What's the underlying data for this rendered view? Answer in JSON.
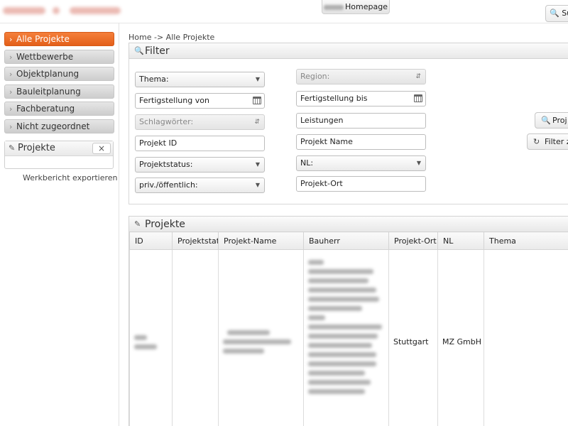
{
  "header": {
    "homepage_label": "Homepage",
    "search_label": "Su"
  },
  "sidebar": {
    "items": [
      {
        "label": "Alle Projekte",
        "active": true
      },
      {
        "label": "Wettbewerbe",
        "active": false
      },
      {
        "label": "Objektplanung",
        "active": false
      },
      {
        "label": "Bauleitplanung",
        "active": false
      },
      {
        "label": "Fachberatung",
        "active": false
      },
      {
        "label": "Nicht zugeordnet",
        "active": false
      }
    ],
    "projects_panel_title": "Projekte",
    "close_label": "×",
    "export_link": "Werkbericht exportieren"
  },
  "breadcrumb": "Home -> Alle Projekte",
  "filter": {
    "title": "Filter",
    "thema": "Thema:",
    "fertigstellung_von": "Fertigstellung von",
    "schlagwoerter": "Schlagwörter:",
    "projekt_id": "Projekt ID",
    "projektstatus": "Projektstatus:",
    "priv_oeffentlich": "priv./öffentlich:",
    "region": "Region:",
    "fertigstellung_bis": "Fertigstellung bis",
    "leistungen": "Leistungen",
    "projekt_name": "Projekt Name",
    "nl": "NL:",
    "projekt_ort": "Projekt-Ort",
    "search_button": "Proj",
    "reset_button": "Filter z"
  },
  "projects": {
    "title": "Projekte",
    "columns": [
      "ID",
      "Projektstatus",
      "Projekt-Name",
      "Bauherr",
      "Projekt-Ort",
      "NL",
      "Thema"
    ],
    "rows": [
      {
        "projekt_ort": "Stuttgart",
        "nl": "MZ GmbH"
      }
    ]
  },
  "colors": {
    "accent": "#ee6a22",
    "nav_inactive": "#d9d9d9",
    "panel_header": "#eeeeee"
  },
  "icons": {
    "search": "magnifier-icon",
    "pencil": "pencil-icon",
    "calendar": "calendar-icon",
    "refresh": "refresh-icon",
    "chevron": "chevron-right-icon"
  }
}
